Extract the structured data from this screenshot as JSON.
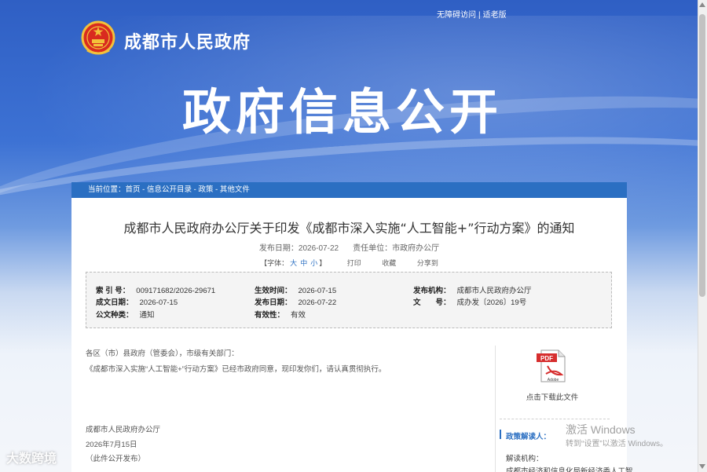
{
  "header": {
    "accessibility_link": "无障碍访问",
    "separator": "|",
    "elder_link": "适老版",
    "site_name": "成都市人民政府",
    "hero_title": "政府信息公开"
  },
  "breadcrumb": {
    "prefix": "当前位置：",
    "items": [
      "首页",
      "信息公开目录",
      "政策",
      "其他文件"
    ],
    "sep": " - "
  },
  "document": {
    "title": "成都市人民政府办公厅关于印发《成都市深入实施“人工智能+”行动方案》的通知",
    "publish_date_label": "发布日期：",
    "publish_date": "2026-07-22",
    "responsible_label": "责任单位：",
    "responsible": "市政府办公厅",
    "font_label": "【字体：",
    "font_large": "大",
    "font_medium": "中",
    "font_small": "小",
    "font_close": "】",
    "print": "打印",
    "favorite": "收藏",
    "share": "分享到"
  },
  "info": {
    "index_no_label": "索 引 号：",
    "index_no": "009171682/2026-29671",
    "effective_time_label": "生效时间：",
    "effective_time": "2026-07-15",
    "issuer_label": "发布机构：",
    "issuer": "成都市人民政府办公厅",
    "written_date_label": "成文日期：",
    "written_date": "2026-07-15",
    "publish_date_label": "发布日期：",
    "publish_date": "2026-07-22",
    "doc_no_label": "文　　号：",
    "doc_no": "成办发〔2026〕19号",
    "category_label": "公文种类：",
    "category": "通知",
    "validity_label": "有效性：",
    "validity": "有效"
  },
  "body": {
    "greeting": "各区（市）县政府（管委会），市级有关部门：",
    "paragraph": "《成都市深入实施“人工智能+”行动方案》已经市政府同意，现印发你们，请认真贯彻执行。",
    "signature": "成都市人民政府办公厅",
    "sign_date": "2026年7月15日",
    "note": "（此件公开发布）"
  },
  "sidebar": {
    "download": "点击下载此文件",
    "pdf_text": "PDF",
    "adobe_text": "Adobe",
    "interp_title": "政策解读人：",
    "interp_org_label": "解读机构：",
    "interp_org": "成都市经济和信息化局新经济委人工智"
  },
  "overlays": {
    "win_title": "激活 Windows",
    "win_sub": "转到“设置”以激活 Windows。",
    "logo_text": "大数跨境"
  },
  "colors": {
    "accent": "#2b6fc2",
    "hero_top": "#2f5fc4"
  }
}
